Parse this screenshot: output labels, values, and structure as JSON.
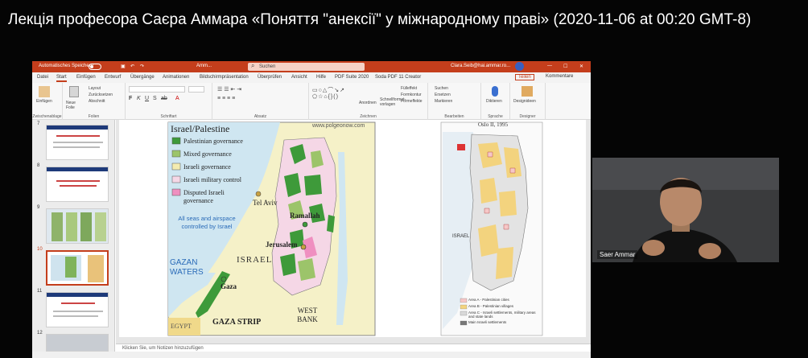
{
  "video": {
    "title": "Лекція професора Саєра Аммара «Поняття \"анексії\" у міжнародному праві» (2020-11-06 at 00:20 GMT-8)"
  },
  "app": {
    "autosave_label": "Automatisches Speichern",
    "doc_name": "Amm...",
    "search_placeholder": "Suchen",
    "user_email": "Clara.Seib@hai.ammar.ro...",
    "menu": [
      "Datei",
      "Start",
      "Einfügen",
      "Entwurf",
      "Übergänge",
      "Animationen",
      "Bildschirmpräsentation",
      "Überprüfen",
      "Ansicht",
      "Hilfe",
      "PDF Suite 2020",
      "Soda PDF 11 Creator"
    ],
    "active_menu": "Start",
    "share_label": "Teilen",
    "comments_label": "Kommentare",
    "ribbon_groups": [
      "Zwischenablage",
      "Folien",
      "Schriftart",
      "Absatz",
      "Zeichnen",
      "Bearbeiten",
      "Sprache",
      "Designer"
    ],
    "ribbon_items": {
      "paste": "Einfügen",
      "new_slide": "Neue Folie",
      "layout": "Layout",
      "reset": "Zurücksetzen",
      "section": "Abschnitt",
      "arrange": "Anordnen",
      "quick_styles": "Schnellformat-vorlagen",
      "fill": "Fülleffekt",
      "outline": "Formkontur",
      "effects": "Formeffekte",
      "find": "Suchen",
      "replace": "Ersetzen",
      "select": "Markieren",
      "dictate": "Diktieren",
      "designer": "Designideen"
    },
    "notes_placeholder": "Klicken Sie, um Notizen hinzuzufügen",
    "slide_numbers": [
      "7",
      "8",
      "9",
      "10",
      "11",
      "12"
    ],
    "selected_slide": "10"
  },
  "slide": {
    "map_title": "Israel/Palestine",
    "source": "www.polgeonow.com",
    "legend": [
      {
        "label": "Palestinian governance",
        "color": "#3e9a3a"
      },
      {
        "label": "Mixed governance",
        "color": "#9cc46a"
      },
      {
        "label": "Israeli governance",
        "color": "#f4ecb0"
      },
      {
        "label": "Israeli military control",
        "color": "#f5d7e6"
      },
      {
        "label": "Disputed Israeli governance",
        "color": "#ef8fc0"
      }
    ],
    "sea_note": "All seas and airspace controlled by Israel",
    "places": {
      "tel_aviv": "Tel Aviv",
      "ramallah": "Ramallah",
      "jerusalem": "Jerusalem",
      "israel": "ISRAEL",
      "gazan_waters": "GAZAN WATERS",
      "gaza": "Gaza",
      "gaza_strip": "GAZA STRIP",
      "west_bank": "WEST BANK",
      "egypt": "EGYPT"
    },
    "oslo_title": "Oslo II, 1995",
    "oslo_israel": "ISRAEL",
    "oslo_legend": [
      {
        "label": "Area A - Palestinian cities",
        "color": "#f6c7c7"
      },
      {
        "label": "Area B - Palestinian villages",
        "color": "#f3d37e"
      },
      {
        "label": "Area C - Israeli settlements, military areas and state lands",
        "color": "#d9d9d9"
      },
      {
        "label": "Main Israeli settlements",
        "color": "#777777"
      }
    ]
  },
  "camera": {
    "name": "Saer Ammar"
  }
}
